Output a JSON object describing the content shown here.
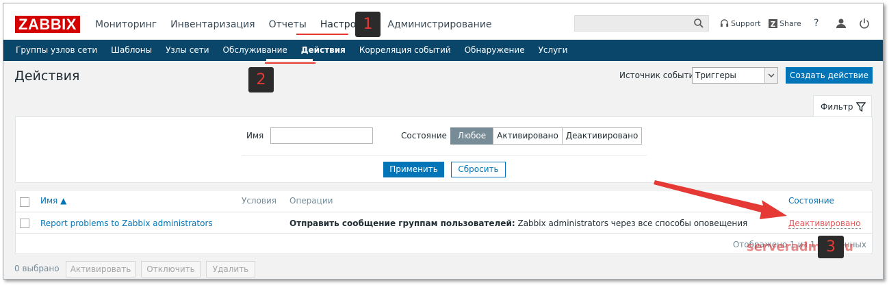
{
  "logo": "ZABBIX",
  "main_nav": [
    "Мониторинг",
    "Инвентаризация",
    "Отчеты",
    "Настройка",
    "Администрирование"
  ],
  "top_links": {
    "support": "Support",
    "share": "Share",
    "help": "?"
  },
  "sub_nav": [
    "Группы узлов сети",
    "Шаблоны",
    "Узлы сети",
    "Обслуживание",
    "Действия",
    "Корреляция событий",
    "Обнаружение",
    "Услуги"
  ],
  "page": {
    "title": "Действия",
    "event_source_label": "Источник событий",
    "event_source_value": "Триггеры",
    "create_button": "Создать действие"
  },
  "filter": {
    "tab_label": "Фильтр",
    "name_label": "Имя",
    "name_value": "",
    "state_label": "Состояние",
    "state_options": [
      "Любое",
      "Активировано",
      "Деактивировано"
    ],
    "state_selected": "Любое",
    "apply_button": "Применить",
    "reset_button": "Сбросить"
  },
  "table": {
    "columns": {
      "name": "Имя ▲",
      "conditions": "Условия",
      "operations": "Операции",
      "status": "Состояние"
    },
    "rows": [
      {
        "name": "Report problems to Zabbix administrators",
        "conditions": "",
        "operation_bold": "Отправить сообщение группам пользователей:",
        "operation_rest": " Zabbix administrators через все способы оповещения",
        "status": "Деактивировано"
      }
    ],
    "shown_text": "Отображено 1 из 1 найденных"
  },
  "bottom": {
    "selected": "0 выбрано",
    "activate": "Активировать",
    "disable": "Отключить",
    "delete": "Удалить"
  },
  "annotations": {
    "marker1": "1",
    "marker2": "2",
    "marker3": "3",
    "watermark": "serveradmin.ru",
    "color": "#e53935"
  },
  "colors": {
    "brand": "#d40000",
    "subnav": "#0a466a",
    "accent": "#0275b8",
    "disabled_status": "#e45959"
  }
}
